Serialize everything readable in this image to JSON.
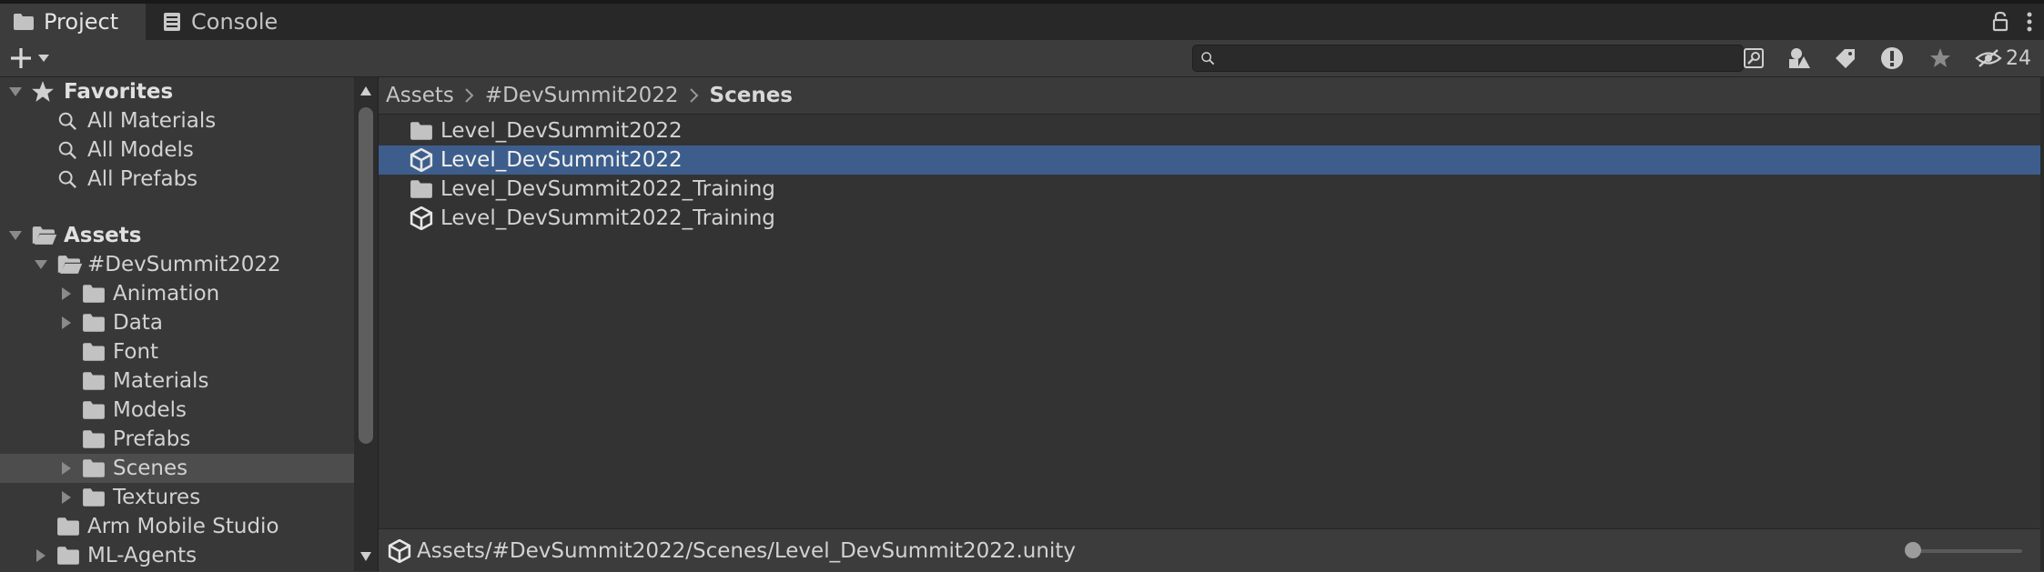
{
  "tabs": [
    {
      "label": "Project",
      "icon": "folder-icon",
      "active": true
    },
    {
      "label": "Console",
      "icon": "console-icon",
      "active": false
    }
  ],
  "toolbar": {
    "search_value": "",
    "hidden_count": "24"
  },
  "sidebar": {
    "favorites_label": "Favorites",
    "favorites": [
      "All Materials",
      "All Models",
      "All Prefabs"
    ],
    "assets_label": "Assets",
    "tree": [
      {
        "label": "#DevSummit2022"
      },
      {
        "label": "Animation"
      },
      {
        "label": "Data"
      },
      {
        "label": "Font"
      },
      {
        "label": "Materials"
      },
      {
        "label": "Models"
      },
      {
        "label": "Prefabs"
      },
      {
        "label": "Scenes",
        "selected": true
      },
      {
        "label": "Textures"
      },
      {
        "label": "Arm Mobile Studio"
      },
      {
        "label": "ML-Agents"
      }
    ]
  },
  "breadcrumb": [
    "Assets",
    "#DevSummit2022",
    "Scenes"
  ],
  "files": [
    {
      "label": "Level_DevSummit2022",
      "icon": "folder-icon"
    },
    {
      "label": "Level_DevSummit2022",
      "icon": "unity-scene-icon",
      "selected": true
    },
    {
      "label": "Level_DevSummit2022_Training",
      "icon": "folder-icon"
    },
    {
      "label": "Level_DevSummit2022_Training",
      "icon": "unity-scene-icon"
    }
  ],
  "status": {
    "path": "Assets/#DevSummit2022/Scenes/Level_DevSummit2022.unity",
    "zoom": 0
  },
  "colors": {
    "selection": "#3d5e8c",
    "background": "#383838"
  }
}
